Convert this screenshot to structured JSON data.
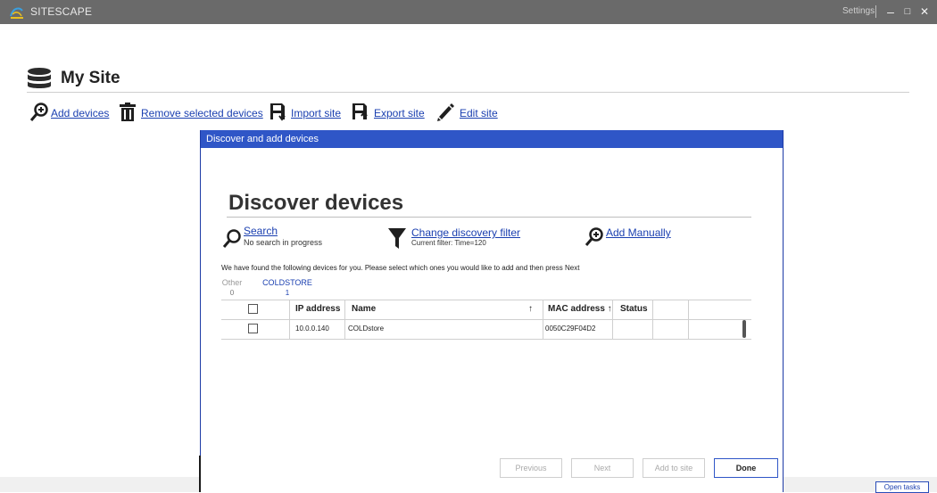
{
  "app": {
    "name": "SITESCAPE",
    "settings_label": "Settings",
    "minimize_glyph": "–",
    "maximize_glyph": "□",
    "close_glyph": "✕"
  },
  "site": {
    "title": "My Site",
    "icon": "database-icon"
  },
  "toolbar": {
    "items": [
      {
        "label": "Add devices",
        "icon": "add-search-icon"
      },
      {
        "label": "Remove selected devices",
        "icon": "trash-icon"
      },
      {
        "label": "Import site",
        "icon": "import-icon"
      },
      {
        "label": "Export site",
        "icon": "export-icon"
      },
      {
        "label": "Edit site",
        "icon": "pencil-icon"
      }
    ]
  },
  "dialog": {
    "title": "Discover and add devices",
    "heading": "Discover devices",
    "search": {
      "label": "Search",
      "status": "No search in progress"
    },
    "filter": {
      "label": "Change discovery filter",
      "current": "Current filter: Time=120"
    },
    "manual": {
      "label": "Add Manually"
    },
    "found_message": "We have found the following devices for you. Please select which ones you would like to add and then press Next",
    "groups": [
      {
        "name": "Other",
        "count": "0",
        "active": false
      },
      {
        "name": "COLDSTORE",
        "count": "1",
        "active": true
      }
    ],
    "table": {
      "columns": {
        "ip": "IP address",
        "name": "Name",
        "name_sort": "↑",
        "mac": "MAC address ↑",
        "status": "Status"
      },
      "rows": [
        {
          "checked": false,
          "ip": "10.0.0.140",
          "name": "COLDstore",
          "mac": "0050C29F04D2",
          "status": ""
        }
      ]
    },
    "buttons": {
      "previous": "Previous",
      "next": "Next",
      "add": "Add to site",
      "done": "Done"
    }
  },
  "footer": {
    "open_tasks": "Open tasks"
  },
  "colors": {
    "accent": "#2f56c7",
    "link": "#1a3fb0",
    "titlebar": "#6a6a6a"
  }
}
